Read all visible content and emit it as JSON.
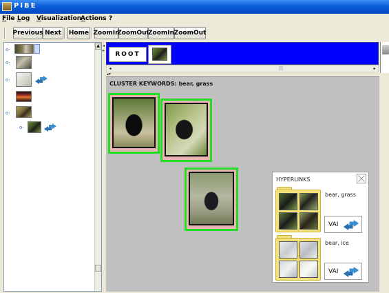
{
  "window": {
    "title": "PIBE"
  },
  "menu": {
    "items": [
      {
        "label": "File",
        "mnemonic": "F",
        "rest": "ile"
      },
      {
        "label": "Log",
        "mnemonic": "L",
        "rest": "og"
      },
      {
        "label": "Visualization",
        "mnemonic": "V",
        "rest": "isualization"
      },
      {
        "label": "Actions",
        "mnemonic": "A",
        "rest": "ctions"
      },
      {
        "label": "?",
        "mnemonic": "",
        "rest": "?"
      }
    ]
  },
  "toolbar": {
    "previous": "Previous",
    "next": "Next",
    "home": "Home",
    "zoomin1": "ZoomIn",
    "zoomout1": "ZoomOut",
    "zoomin2": "ZoomIn",
    "zoomout2": "ZoomOut"
  },
  "root": {
    "label": "ROOT"
  },
  "cluster": {
    "keywords": "CLUSTER KEYWORDS: bear, grass"
  },
  "hyperlinks": {
    "title": "HYPERLINKS",
    "links": [
      {
        "keywords": "bear, grass",
        "button": "VAI"
      },
      {
        "keywords": "bear, ice",
        "button": "VAI"
      }
    ]
  },
  "icons": {
    "arrow": "bidirectional-arrow-icon",
    "close": "close-icon",
    "trash": "trash-icon",
    "app": "app-icon"
  },
  "colors": {
    "root_bar": "#0000ff",
    "card_border": "#22dd22",
    "folder": "#f3e27a"
  }
}
